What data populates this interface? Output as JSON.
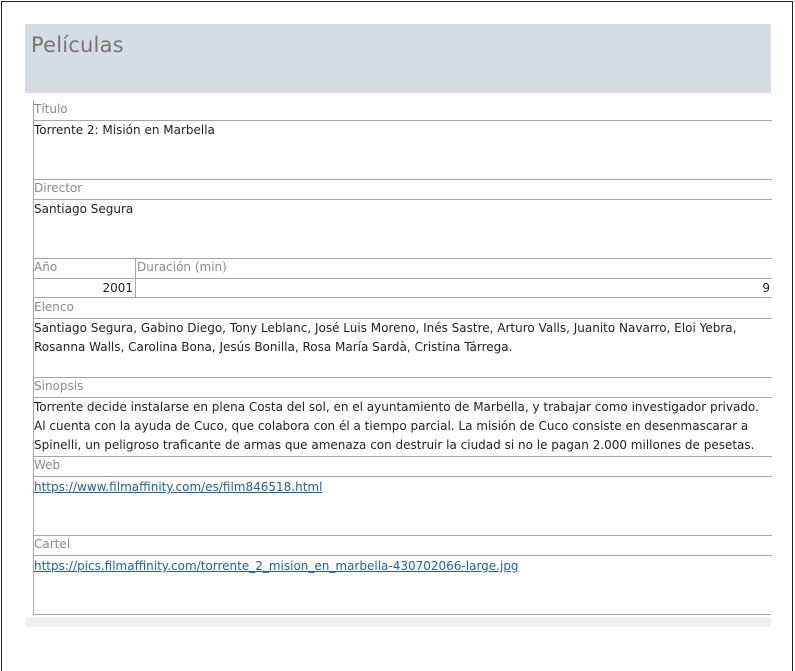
{
  "header": {
    "title": "Películas"
  },
  "fields": {
    "titulo": {
      "label": "Título",
      "value": "Torrente 2: Misión en Marbella"
    },
    "director": {
      "label": "Director",
      "value": "Santiago Segura"
    },
    "anio": {
      "label": "Año",
      "value": "2001"
    },
    "duracion": {
      "label": "Duración (min)",
      "value": "9"
    },
    "elenco": {
      "label": "Elenco",
      "value": "Santiago Segura, Gabino Diego, Tony Leblanc, José Luis Moreno, Inés Sastre, Arturo Valls, Juanito Navarro, Eloi Yebra, Rosanna Walls, Carolina Bona, Jesús Bonilla, Rosa María Sardà, Cristina Tárrega."
    },
    "sinopsis": {
      "label": "Sinopsis",
      "value": "Torrente decide instalarse en plena Costa del sol, en el ayuntamiento de Marbella, y trabajar como investigador privado. Al cuenta con la ayuda de Cuco, que colabora con él a tiempo parcial. La misión de Cuco consiste en desenmascarar a Spinelli, un peligroso traficante de armas que amenaza con destruir la ciudad si no le pagan 2.000 millones de pesetas."
    },
    "web": {
      "label": "Web",
      "value": "https://www.filmaffinity.com/es/film846518.html"
    },
    "cartel": {
      "label": "Cartel",
      "value": "https://pics.filmaffinity.com/torrente_2_mision_en_marbella-430702066-large.jpg"
    }
  },
  "colors": {
    "header_bg": "#d6dce4",
    "link": "#1f5fad"
  }
}
